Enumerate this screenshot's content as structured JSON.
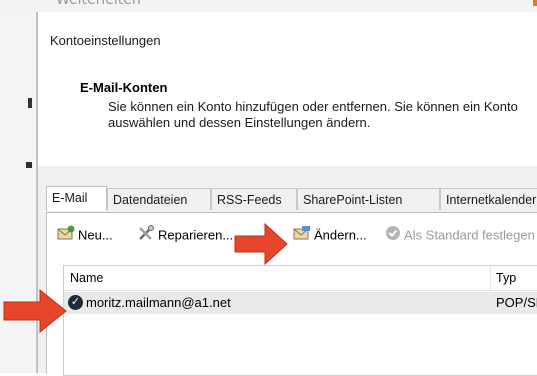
{
  "dialog": {
    "title": "Kontoeinstellungen",
    "section_heading": "E-Mail-Konten",
    "section_description": "Sie können ein Konto hinzufügen oder entfernen. Sie können ein Konto auswählen und dessen Einstellungen ändern."
  },
  "background": {
    "ghost_text": "Weiterleiten"
  },
  "tabs": [
    {
      "label": "E-Mail",
      "active": true
    },
    {
      "label": "Datendateien",
      "active": false
    },
    {
      "label": "RSS-Feeds",
      "active": false
    },
    {
      "label": "SharePoint-Listen",
      "active": false
    },
    {
      "label": "Internetkalender",
      "active": false
    }
  ],
  "toolbar": {
    "new_label": "Neu...",
    "repair_label": "Reparieren...",
    "change_label": "Ändern...",
    "default_label": "Als Standard festlegen"
  },
  "list": {
    "col_name": "Name",
    "col_type": "Typ",
    "rows": [
      {
        "account": "moritz.mailmann@a1.net",
        "type": "POP/SMTP"
      }
    ]
  },
  "colors": {
    "accent_arrow": "#e8462a",
    "selected_row": "#e9e9e9",
    "tab_bg": "#f0f0f0"
  }
}
